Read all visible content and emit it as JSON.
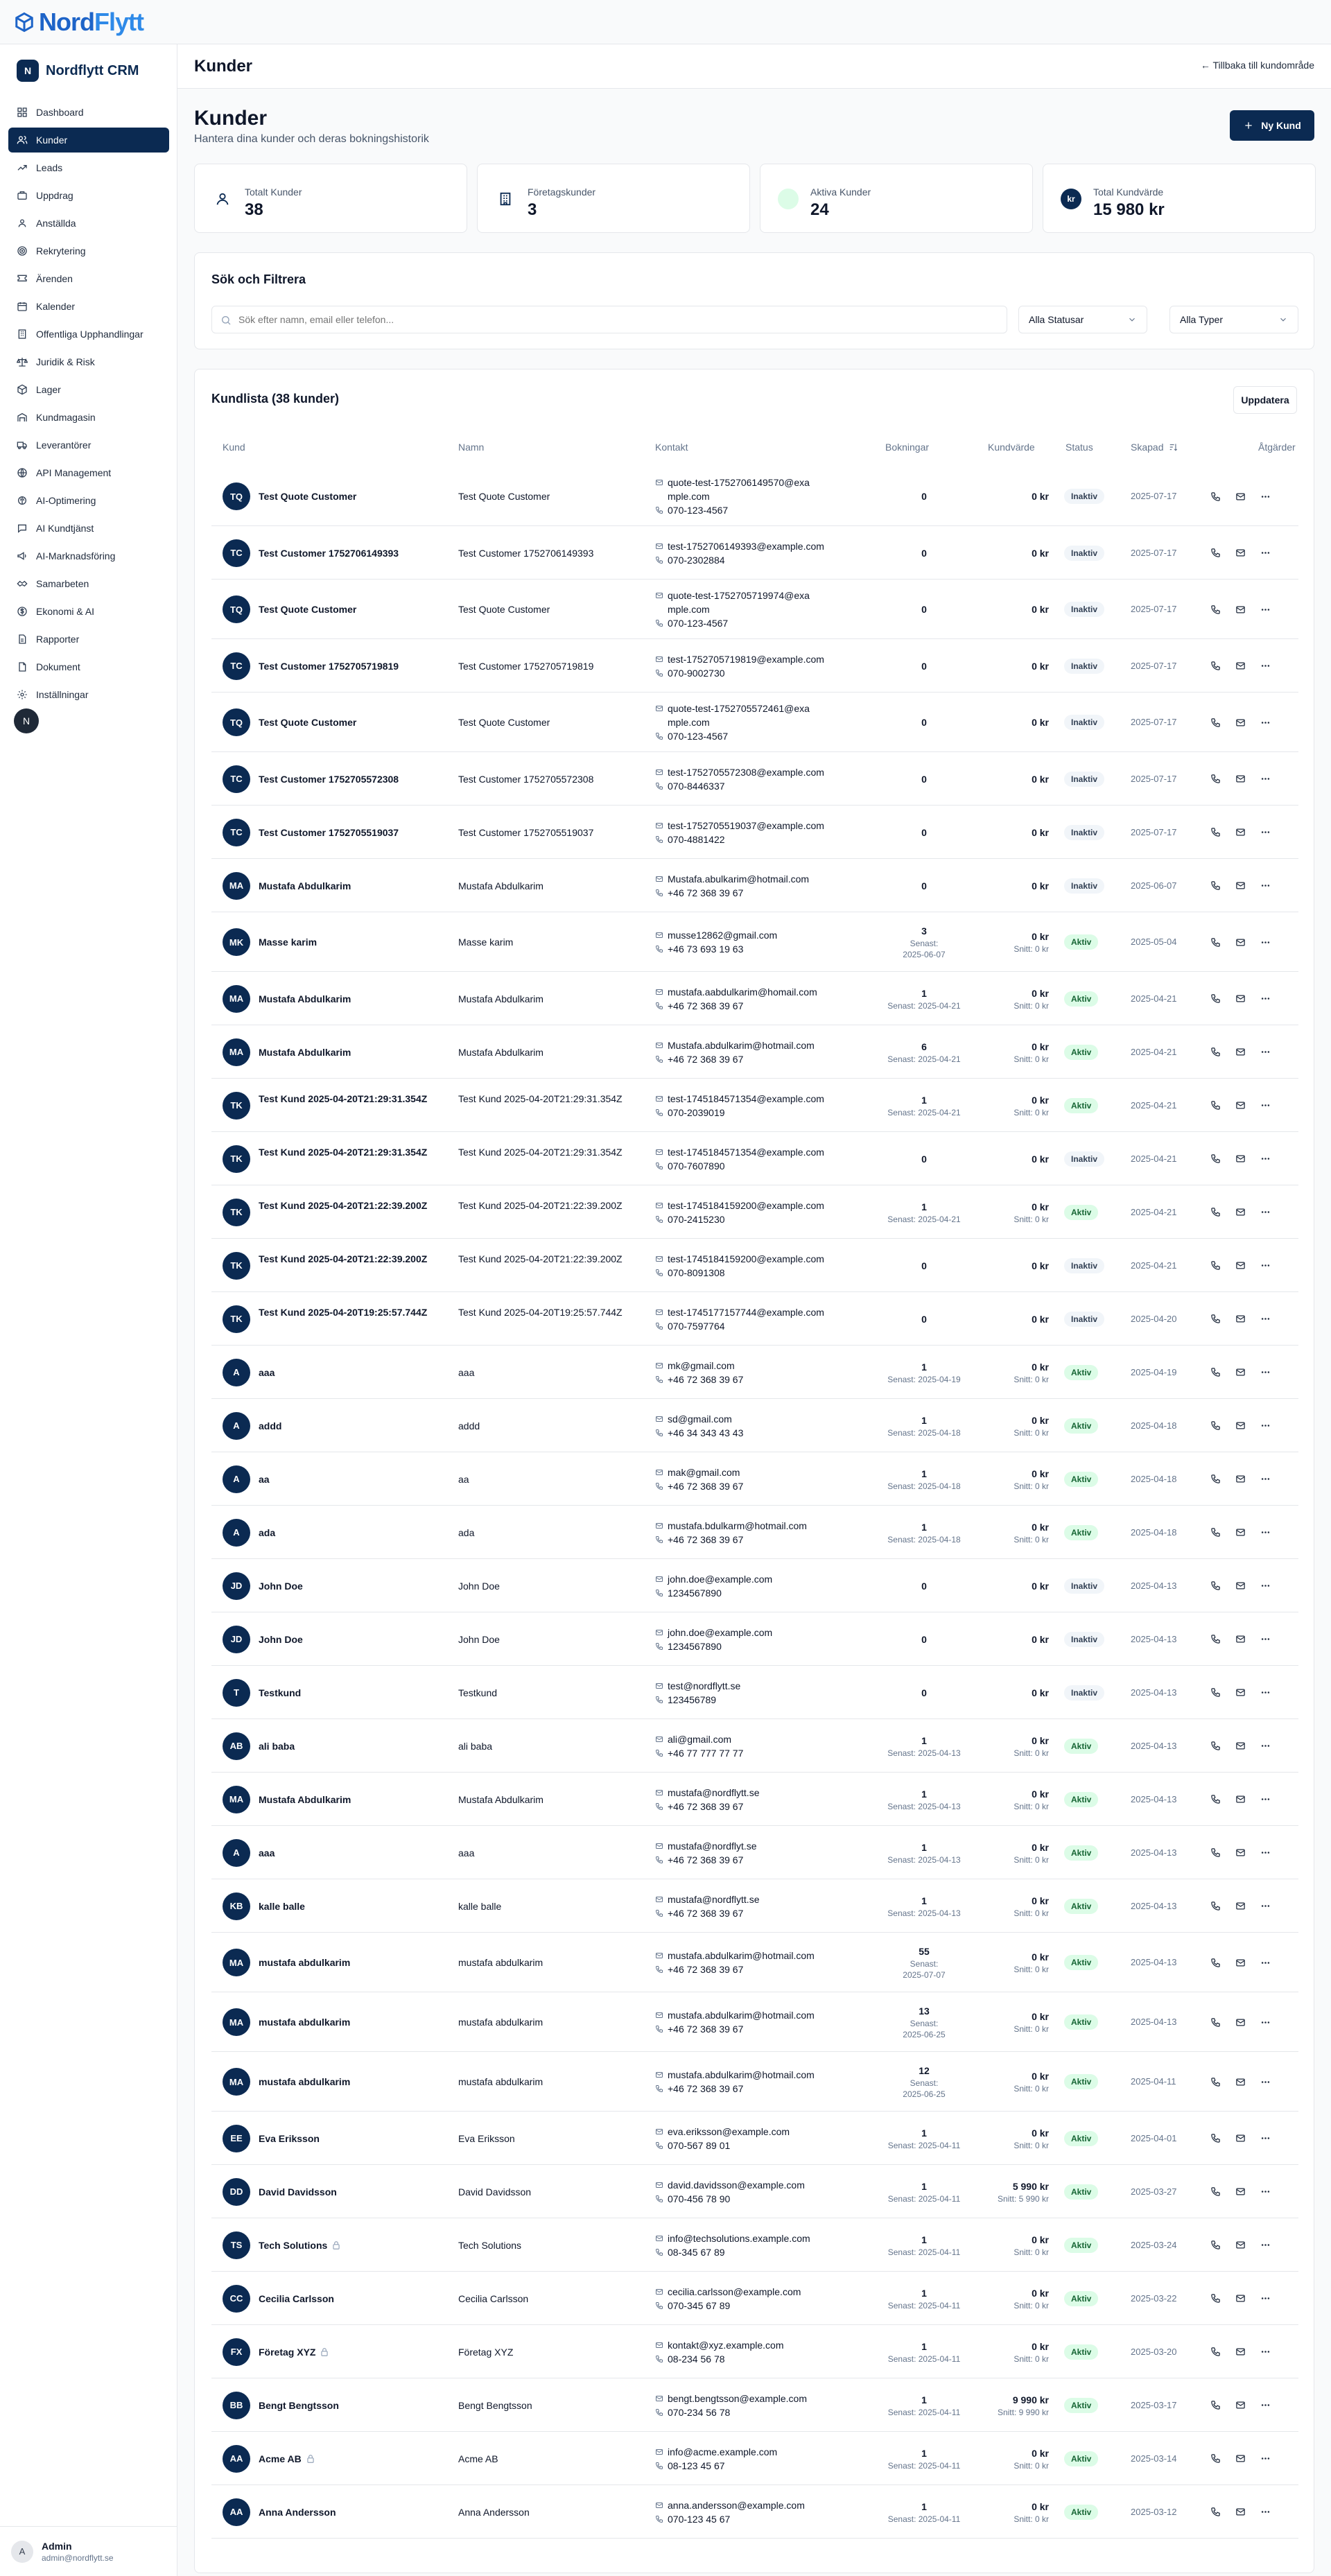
{
  "logo": {
    "part1": "Nord",
    "part2": "Flytt"
  },
  "sidebar": {
    "brand_badge": "N",
    "brand_name": "Nordflytt CRM",
    "items": [
      {
        "label": "Dashboard",
        "icon": "dashboard-icon"
      },
      {
        "label": "Kunder",
        "icon": "users-icon"
      },
      {
        "label": "Leads",
        "icon": "trending-icon"
      },
      {
        "label": "Uppdrag",
        "icon": "briefcase-icon"
      },
      {
        "label": "Anställda",
        "icon": "user-group-icon"
      },
      {
        "label": "Rekrytering",
        "icon": "target-icon"
      },
      {
        "label": "Ärenden",
        "icon": "ticket-icon"
      },
      {
        "label": "Kalender",
        "icon": "calendar-icon"
      },
      {
        "label": "Offentliga Upphandlingar",
        "icon": "building-icon"
      },
      {
        "label": "Juridik & Risk",
        "icon": "scale-icon"
      },
      {
        "label": "Lager",
        "icon": "box-icon"
      },
      {
        "label": "Kundmagasin",
        "icon": "warehouse-icon"
      },
      {
        "label": "Leverantörer",
        "icon": "truck-icon"
      },
      {
        "label": "API Management",
        "icon": "globe-icon"
      },
      {
        "label": "AI-Optimering",
        "icon": "brain-icon"
      },
      {
        "label": "AI Kundtjänst",
        "icon": "chat-icon"
      },
      {
        "label": "AI-Marknadsföring",
        "icon": "megaphone-icon"
      },
      {
        "label": "Samarbeten",
        "icon": "handshake-icon"
      },
      {
        "label": "Ekonomi & AI",
        "icon": "dollar-icon"
      },
      {
        "label": "Rapporter",
        "icon": "report-icon"
      },
      {
        "label": "Dokument",
        "icon": "document-icon"
      },
      {
        "label": "Inställningar",
        "icon": "gear-icon"
      }
    ],
    "dot_label": "N",
    "user": {
      "initial": "A",
      "name": "Admin",
      "email": "admin@nordflytt.se"
    }
  },
  "header": {
    "title": "Kunder",
    "back_link": "← Tillbaka till kundområde"
  },
  "page": {
    "title": "Kunder",
    "subtitle": "Hantera dina kunder och deras bokningshistorik",
    "new_button": "Ny Kund"
  },
  "stats": [
    {
      "label": "Totalt Kunder",
      "value": "38"
    },
    {
      "label": "Företagskunder",
      "value": "3"
    },
    {
      "label": "Aktiva Kunder",
      "value": "24"
    },
    {
      "label": "Total Kundvärde",
      "value": "15 980 kr",
      "icon_text": "kr"
    }
  ],
  "search": {
    "title": "Sök och Filtrera",
    "placeholder": "Sök efter namn, email eller telefon...",
    "status_filter": "Alla Statusar",
    "type_filter": "Alla Typer"
  },
  "list": {
    "title": "Kundlista (38 kunder)",
    "refresh": "Uppdatera",
    "columns": [
      "Kund",
      "Namn",
      "Kontakt",
      "Bokningar",
      "Kundvärde",
      "Status",
      "Skapad",
      "Åtgärder"
    ],
    "rows": [
      {
        "initials": "TQ",
        "kund": "Test Quote Customer",
        "namn": "Test Quote Customer",
        "email": "quote-test-1752706149570@example.com",
        "phone": "070-123-4567",
        "bok": "0",
        "bok_sub": "",
        "kv": "0 kr",
        "kv_sub": "",
        "status": "Inaktiv",
        "skapad": "2025-07-17",
        "company": false
      },
      {
        "initials": "TC",
        "kund": "Test Customer 1752706149393",
        "namn": "Test Customer 1752706149393",
        "email": "test-1752706149393@example.com",
        "phone": "070-2302884",
        "bok": "0",
        "bok_sub": "",
        "kv": "0 kr",
        "kv_sub": "",
        "status": "Inaktiv",
        "skapad": "2025-07-17",
        "company": false
      },
      {
        "initials": "TQ",
        "kund": "Test Quote Customer",
        "namn": "Test Quote Customer",
        "email": "quote-test-1752705719974@example.com",
        "phone": "070-123-4567",
        "bok": "0",
        "bok_sub": "",
        "kv": "0 kr",
        "kv_sub": "",
        "status": "Inaktiv",
        "skapad": "2025-07-17",
        "company": false
      },
      {
        "initials": "TC",
        "kund": "Test Customer 1752705719819",
        "namn": "Test Customer 1752705719819",
        "email": "test-1752705719819@example.com",
        "phone": "070-9002730",
        "bok": "0",
        "bok_sub": "",
        "kv": "0 kr",
        "kv_sub": "",
        "status": "Inaktiv",
        "skapad": "2025-07-17",
        "company": false
      },
      {
        "initials": "TQ",
        "kund": "Test Quote Customer",
        "namn": "Test Quote Customer",
        "email": "quote-test-1752705572461@example.com",
        "phone": "070-123-4567",
        "bok": "0",
        "bok_sub": "",
        "kv": "0 kr",
        "kv_sub": "",
        "status": "Inaktiv",
        "skapad": "2025-07-17",
        "company": false
      },
      {
        "initials": "TC",
        "kund": "Test Customer 1752705572308",
        "namn": "Test Customer 1752705572308",
        "email": "test-1752705572308@example.com",
        "phone": "070-8446337",
        "bok": "0",
        "bok_sub": "",
        "kv": "0 kr",
        "kv_sub": "",
        "status": "Inaktiv",
        "skapad": "2025-07-17",
        "company": false
      },
      {
        "initials": "TC",
        "kund": "Test Customer 1752705519037",
        "namn": "Test Customer 1752705519037",
        "email": "test-1752705519037@example.com",
        "phone": "070-4881422",
        "bok": "0",
        "bok_sub": "",
        "kv": "0 kr",
        "kv_sub": "",
        "status": "Inaktiv",
        "skapad": "2025-07-17",
        "company": false
      },
      {
        "initials": "MA",
        "kund": "Mustafa Abdulkarim",
        "namn": "Mustafa Abdulkarim",
        "email": "Mustafa.abulkarim@hotmail.com",
        "phone": "+46 72 368 39 67",
        "bok": "0",
        "bok_sub": "",
        "kv": "0 kr",
        "kv_sub": "",
        "status": "Inaktiv",
        "skapad": "2025-06-07",
        "company": false
      },
      {
        "initials": "MK",
        "kund": "Masse karim",
        "namn": "Masse karim",
        "email": "musse12862@gmail.com",
        "phone": "+46 73 693 19 63",
        "bok": "3",
        "bok_sub": "Senast: 2025-06-07",
        "kv": "0 kr",
        "kv_sub": "Snitt: 0 kr",
        "status": "Aktiv",
        "skapad": "2025-05-04",
        "company": false
      },
      {
        "initials": "MA",
        "kund": "Mustafa Abdulkarim",
        "namn": "Mustafa Abdulkarim",
        "email": "mustafa.aabdulkarim@homail.com",
        "phone": "+46 72 368 39 67",
        "bok": "1",
        "bok_sub": "Senast: 2025-04-21",
        "kv": "0 kr",
        "kv_sub": "Snitt: 0 kr",
        "status": "Aktiv",
        "skapad": "2025-04-21",
        "company": false
      },
      {
        "initials": "MA",
        "kund": "Mustafa Abdulkarim",
        "namn": "Mustafa Abdulkarim",
        "email": "Mustafa.abdulkarim@hotmail.com",
        "phone": "+46 72 368 39 67",
        "bok": "6",
        "bok_sub": "Senast: 2025-04-21",
        "kv": "0 kr",
        "kv_sub": "Snitt: 0 kr",
        "status": "Aktiv",
        "skapad": "2025-04-21",
        "company": false
      },
      {
        "initials": "TK",
        "kund": "Test Kund 2025-04-20T21:29:31.354Z",
        "namn": "Test Kund 2025-04-20T21:29:31.354Z",
        "email": "test-1745184571354@example.com",
        "phone": "070-2039019",
        "bok": "1",
        "bok_sub": "Senast: 2025-04-21",
        "kv": "0 kr",
        "kv_sub": "Snitt: 0 kr",
        "status": "Aktiv",
        "skapad": "2025-04-21",
        "company": false
      },
      {
        "initials": "TK",
        "kund": "Test Kund 2025-04-20T21:29:31.354Z",
        "namn": "Test Kund 2025-04-20T21:29:31.354Z",
        "email": "test-1745184571354@example.com",
        "phone": "070-7607890",
        "bok": "0",
        "bok_sub": "",
        "kv": "0 kr",
        "kv_sub": "",
        "status": "Inaktiv",
        "skapad": "2025-04-21",
        "company": false
      },
      {
        "initials": "TK",
        "kund": "Test Kund 2025-04-20T21:22:39.200Z",
        "namn": "Test Kund 2025-04-20T21:22:39.200Z",
        "email": "test-1745184159200@example.com",
        "phone": "070-2415230",
        "bok": "1",
        "bok_sub": "Senast: 2025-04-21",
        "kv": "0 kr",
        "kv_sub": "Snitt: 0 kr",
        "status": "Aktiv",
        "skapad": "2025-04-21",
        "company": false
      },
      {
        "initials": "TK",
        "kund": "Test Kund 2025-04-20T21:22:39.200Z",
        "namn": "Test Kund 2025-04-20T21:22:39.200Z",
        "email": "test-1745184159200@example.com",
        "phone": "070-8091308",
        "bok": "0",
        "bok_sub": "",
        "kv": "0 kr",
        "kv_sub": "",
        "status": "Inaktiv",
        "skapad": "2025-04-21",
        "company": false
      },
      {
        "initials": "TK",
        "kund": "Test Kund 2025-04-20T19:25:57.744Z",
        "namn": "Test Kund 2025-04-20T19:25:57.744Z",
        "email": "test-1745177157744@example.com",
        "phone": "070-7597764",
        "bok": "0",
        "bok_sub": "",
        "kv": "0 kr",
        "kv_sub": "",
        "status": "Inaktiv",
        "skapad": "2025-04-20",
        "company": false
      },
      {
        "initials": "A",
        "kund": "aaa",
        "namn": "aaa",
        "email": "mk@gmail.com",
        "phone": "+46 72 368 39 67",
        "bok": "1",
        "bok_sub": "Senast: 2025-04-19",
        "kv": "0 kr",
        "kv_sub": "Snitt: 0 kr",
        "status": "Aktiv",
        "skapad": "2025-04-19",
        "company": false
      },
      {
        "initials": "A",
        "kund": "addd",
        "namn": "addd",
        "email": "sd@gmail.com",
        "phone": "+46 34 343 43 43",
        "bok": "1",
        "bok_sub": "Senast: 2025-04-18",
        "kv": "0 kr",
        "kv_sub": "Snitt: 0 kr",
        "status": "Aktiv",
        "skapad": "2025-04-18",
        "company": false
      },
      {
        "initials": "A",
        "kund": "aa",
        "namn": "aa",
        "email": "mak@gmail.com",
        "phone": "+46 72 368 39 67",
        "bok": "1",
        "bok_sub": "Senast: 2025-04-18",
        "kv": "0 kr",
        "kv_sub": "Snitt: 0 kr",
        "status": "Aktiv",
        "skapad": "2025-04-18",
        "company": false
      },
      {
        "initials": "A",
        "kund": "ada",
        "namn": "ada",
        "email": "mustafa.bdulkarm@hotmail.com",
        "phone": "+46 72 368 39 67",
        "bok": "1",
        "bok_sub": "Senast: 2025-04-18",
        "kv": "0 kr",
        "kv_sub": "Snitt: 0 kr",
        "status": "Aktiv",
        "skapad": "2025-04-18",
        "company": false
      },
      {
        "initials": "JD",
        "kund": "John Doe",
        "namn": "John Doe",
        "email": "john.doe@example.com",
        "phone": "1234567890",
        "bok": "0",
        "bok_sub": "",
        "kv": "0 kr",
        "kv_sub": "",
        "status": "Inaktiv",
        "skapad": "2025-04-13",
        "company": false
      },
      {
        "initials": "JD",
        "kund": "John Doe",
        "namn": "John Doe",
        "email": "john.doe@example.com",
        "phone": "1234567890",
        "bok": "0",
        "bok_sub": "",
        "kv": "0 kr",
        "kv_sub": "",
        "status": "Inaktiv",
        "skapad": "2025-04-13",
        "company": false
      },
      {
        "initials": "T",
        "kund": "Testkund",
        "namn": "Testkund",
        "email": "test@nordflytt.se",
        "phone": "123456789",
        "bok": "0",
        "bok_sub": "",
        "kv": "0 kr",
        "kv_sub": "",
        "status": "Inaktiv",
        "skapad": "2025-04-13",
        "company": false
      },
      {
        "initials": "AB",
        "kund": "ali baba",
        "namn": "ali baba",
        "email": "ali@gmail.com",
        "phone": "+46 77 777 77 77",
        "bok": "1",
        "bok_sub": "Senast: 2025-04-13",
        "kv": "0 kr",
        "kv_sub": "Snitt: 0 kr",
        "status": "Aktiv",
        "skapad": "2025-04-13",
        "company": false
      },
      {
        "initials": "MA",
        "kund": "Mustafa Abdulkarim",
        "namn": "Mustafa Abdulkarim",
        "email": "mustafa@nordflytt.se",
        "phone": "+46 72 368 39 67",
        "bok": "1",
        "bok_sub": "Senast: 2025-04-13",
        "kv": "0 kr",
        "kv_sub": "Snitt: 0 kr",
        "status": "Aktiv",
        "skapad": "2025-04-13",
        "company": false
      },
      {
        "initials": "A",
        "kund": "aaa",
        "namn": "aaa",
        "email": "mustafa@nordflyt.se",
        "phone": "+46 72 368 39 67",
        "bok": "1",
        "bok_sub": "Senast: 2025-04-13",
        "kv": "0 kr",
        "kv_sub": "Snitt: 0 kr",
        "status": "Aktiv",
        "skapad": "2025-04-13",
        "company": false
      },
      {
        "initials": "KB",
        "kund": "kalle balle",
        "namn": "kalle balle",
        "email": "mustafa@nordflytt.se",
        "phone": "+46 72 368 39 67",
        "bok": "1",
        "bok_sub": "Senast: 2025-04-13",
        "kv": "0 kr",
        "kv_sub": "Snitt: 0 kr",
        "status": "Aktiv",
        "skapad": "2025-04-13",
        "company": false
      },
      {
        "initials": "MA",
        "kund": "mustafa abdulkarim",
        "namn": "mustafa abdulkarim",
        "email": "mustafa.abdulkarim@hotmail.com",
        "phone": "+46 72 368 39 67",
        "bok": "55",
        "bok_sub": "Senast: 2025-07-07",
        "kv": "0 kr",
        "kv_sub": "Snitt: 0 kr",
        "status": "Aktiv",
        "skapad": "2025-04-13",
        "company": false
      },
      {
        "initials": "MA",
        "kund": "mustafa abdulkarim",
        "namn": "mustafa abdulkarim",
        "email": "mustafa.abdulkarim@hotmail.com",
        "phone": "+46 72 368 39 67",
        "bok": "13",
        "bok_sub": "Senast: 2025-06-25",
        "kv": "0 kr",
        "kv_sub": "Snitt: 0 kr",
        "status": "Aktiv",
        "skapad": "2025-04-13",
        "company": false
      },
      {
        "initials": "MA",
        "kund": "mustafa abdulkarim",
        "namn": "mustafa abdulkarim",
        "email": "mustafa.abdulkarim@hotmail.com",
        "phone": "+46 72 368 39 67",
        "bok": "12",
        "bok_sub": "Senast: 2025-06-25",
        "kv": "0 kr",
        "kv_sub": "Snitt: 0 kr",
        "status": "Aktiv",
        "skapad": "2025-04-11",
        "company": false
      },
      {
        "initials": "EE",
        "kund": "Eva Eriksson",
        "namn": "Eva Eriksson",
        "email": "eva.eriksson@example.com",
        "phone": "070-567 89 01",
        "bok": "1",
        "bok_sub": "Senast: 2025-04-11",
        "kv": "0 kr",
        "kv_sub": "Snitt: 0 kr",
        "status": "Aktiv",
        "skapad": "2025-04-01",
        "company": false
      },
      {
        "initials": "DD",
        "kund": "David Davidsson",
        "namn": "David Davidsson",
        "email": "david.davidsson@example.com",
        "phone": "070-456 78 90",
        "bok": "1",
        "bok_sub": "Senast: 2025-04-11",
        "kv": "5 990 kr",
        "kv_sub": "Snitt: 5 990 kr",
        "status": "Aktiv",
        "skapad": "2025-03-27",
        "company": false
      },
      {
        "initials": "TS",
        "kund": "Tech Solutions",
        "namn": "Tech Solutions",
        "email": "info@techsolutions.example.com",
        "phone": "08-345 67 89",
        "bok": "1",
        "bok_sub": "Senast: 2025-04-11",
        "kv": "0 kr",
        "kv_sub": "Snitt: 0 kr",
        "status": "Aktiv",
        "skapad": "2025-03-24",
        "company": true
      },
      {
        "initials": "CC",
        "kund": "Cecilia Carlsson",
        "namn": "Cecilia Carlsson",
        "email": "cecilia.carlsson@example.com",
        "phone": "070-345 67 89",
        "bok": "1",
        "bok_sub": "Senast: 2025-04-11",
        "kv": "0 kr",
        "kv_sub": "Snitt: 0 kr",
        "status": "Aktiv",
        "skapad": "2025-03-22",
        "company": false
      },
      {
        "initials": "FX",
        "kund": "Företag XYZ",
        "namn": "Företag XYZ",
        "email": "kontakt@xyz.example.com",
        "phone": "08-234 56 78",
        "bok": "1",
        "bok_sub": "Senast: 2025-04-11",
        "kv": "0 kr",
        "kv_sub": "Snitt: 0 kr",
        "status": "Aktiv",
        "skapad": "2025-03-20",
        "company": true
      },
      {
        "initials": "BB",
        "kund": "Bengt Bengtsson",
        "namn": "Bengt Bengtsson",
        "email": "bengt.bengtsson@example.com",
        "phone": "070-234 56 78",
        "bok": "1",
        "bok_sub": "Senast: 2025-04-11",
        "kv": "9 990 kr",
        "kv_sub": "Snitt: 9 990 kr",
        "status": "Aktiv",
        "skapad": "2025-03-17",
        "company": false
      },
      {
        "initials": "AA",
        "kund": "Acme AB",
        "namn": "Acme AB",
        "email": "info@acme.example.com",
        "phone": "08-123 45 67",
        "bok": "1",
        "bok_sub": "Senast: 2025-04-11",
        "kv": "0 kr",
        "kv_sub": "Snitt: 0 kr",
        "status": "Aktiv",
        "skapad": "2025-03-14",
        "company": true
      },
      {
        "initials": "AA",
        "kund": "Anna Andersson",
        "namn": "Anna Andersson",
        "email": "anna.andersson@example.com",
        "phone": "070-123 45 67",
        "bok": "1",
        "bok_sub": "Senast: 2025-04-11",
        "kv": "0 kr",
        "kv_sub": "Snitt: 0 kr",
        "status": "Aktiv",
        "skapad": "2025-03-12",
        "company": false
      }
    ]
  },
  "colors": {
    "primary": "#0b2a52",
    "active_badge": "#dcfce7",
    "inactive_badge": "#f1f5f9",
    "logo": "#1e64c8"
  }
}
